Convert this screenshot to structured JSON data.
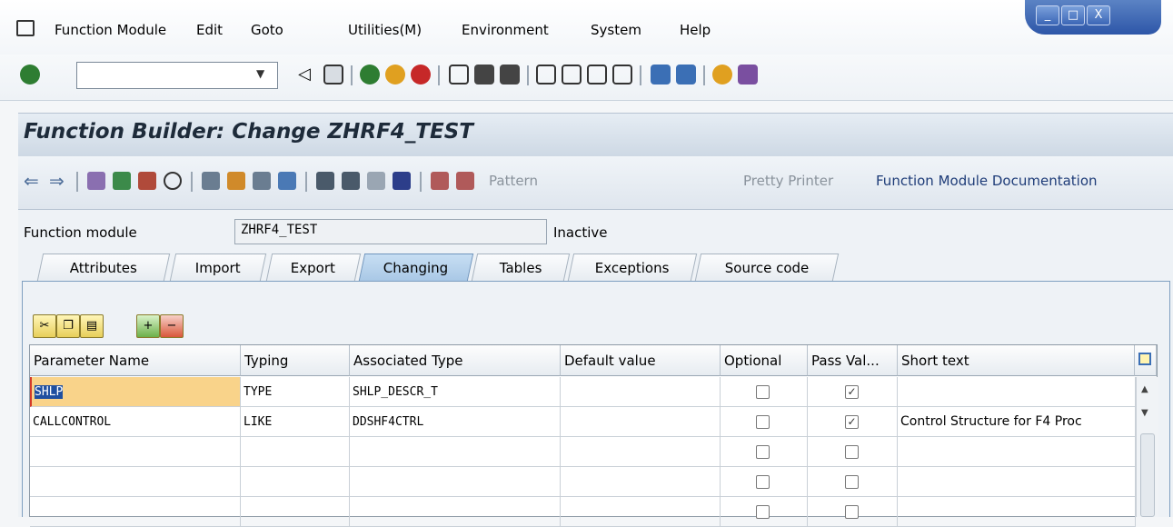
{
  "menu": {
    "items": [
      "Function Module",
      "Edit",
      "Goto",
      "Utilities(M)",
      "Environment",
      "System",
      "Help"
    ]
  },
  "window_controls": [
    "_",
    "□",
    "X"
  ],
  "title": "Function Builder: Change ZHRF4_TEST",
  "app_toolbar": {
    "pattern": "Pattern",
    "pretty_printer": "Pretty Printer",
    "documentation": "Function Module Documentation"
  },
  "function_module": {
    "label": "Function module",
    "value": "ZHRF4_TEST",
    "status": "Inactive"
  },
  "tabs": [
    "Attributes",
    "Import",
    "Export",
    "Changing",
    "Tables",
    "Exceptions",
    "Source code"
  ],
  "active_tab": "Changing",
  "grid": {
    "columns": [
      "Parameter Name",
      "Typing",
      "Associated Type",
      "Default value",
      "Optional",
      "Pass Val...",
      "Short text"
    ],
    "rows": [
      {
        "name": "SHLP",
        "typing": "TYPE",
        "assoc": "SHLP_DESCR_T",
        "default": "",
        "optional": false,
        "pass_value": true,
        "short_text": ""
      },
      {
        "name": "CALLCONTROL",
        "typing": "LIKE",
        "assoc": "DDSHF4CTRL",
        "default": "",
        "optional": false,
        "pass_value": true,
        "short_text": "Control Structure for F4 Proc"
      },
      {
        "name": "",
        "typing": "",
        "assoc": "",
        "default": "",
        "optional": false,
        "pass_value": false,
        "short_text": ""
      },
      {
        "name": "",
        "typing": "",
        "assoc": "",
        "default": "",
        "optional": false,
        "pass_value": false,
        "short_text": ""
      },
      {
        "name": "",
        "typing": "",
        "assoc": "",
        "default": "",
        "optional": false,
        "pass_value": false,
        "short_text": ""
      }
    ]
  },
  "colors": {
    "selected_cell": "#f9d38a",
    "active_tab": "#a9c8e6",
    "title_bar": "#cdd8e4"
  }
}
